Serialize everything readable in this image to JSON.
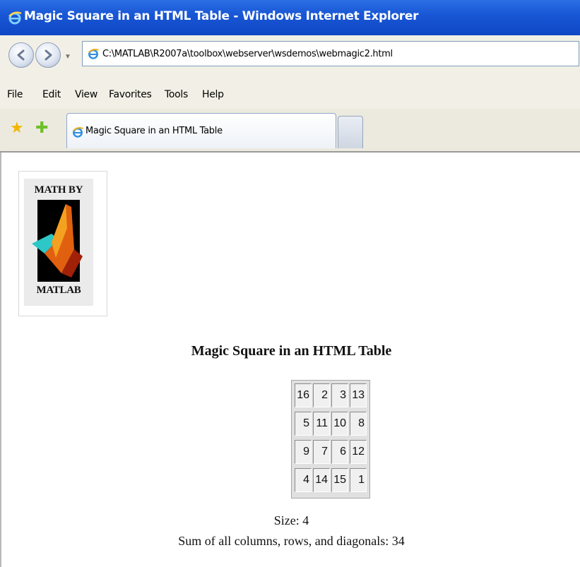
{
  "window": {
    "title": "Magic Square in an HTML Table - Windows Internet Explorer"
  },
  "address": {
    "url": "C:\\MATLAB\\R2007a\\toolbox\\webserver\\wsdemos\\webmagic2.html"
  },
  "menu": [
    "File",
    "Edit",
    "View",
    "Favorites",
    "Tools",
    "Help"
  ],
  "tab": {
    "label": "Magic Square in an HTML Table"
  },
  "logo": {
    "top_text": "MATH BY",
    "bottom_text": "MATLAB"
  },
  "page": {
    "heading": "Magic Square in an HTML Table",
    "magic_square": [
      [
        16,
        2,
        3,
        13
      ],
      [
        5,
        11,
        10,
        8
      ],
      [
        9,
        7,
        6,
        12
      ],
      [
        4,
        14,
        15,
        1
      ]
    ],
    "size_text": "Size: 4",
    "sum_text": "Sum of all columns, rows, and diagonals: 34"
  },
  "colors": {
    "titlebar": "#1957d6",
    "chrome": "#f2f0e6",
    "ie_logo": "#2f8fe0"
  }
}
